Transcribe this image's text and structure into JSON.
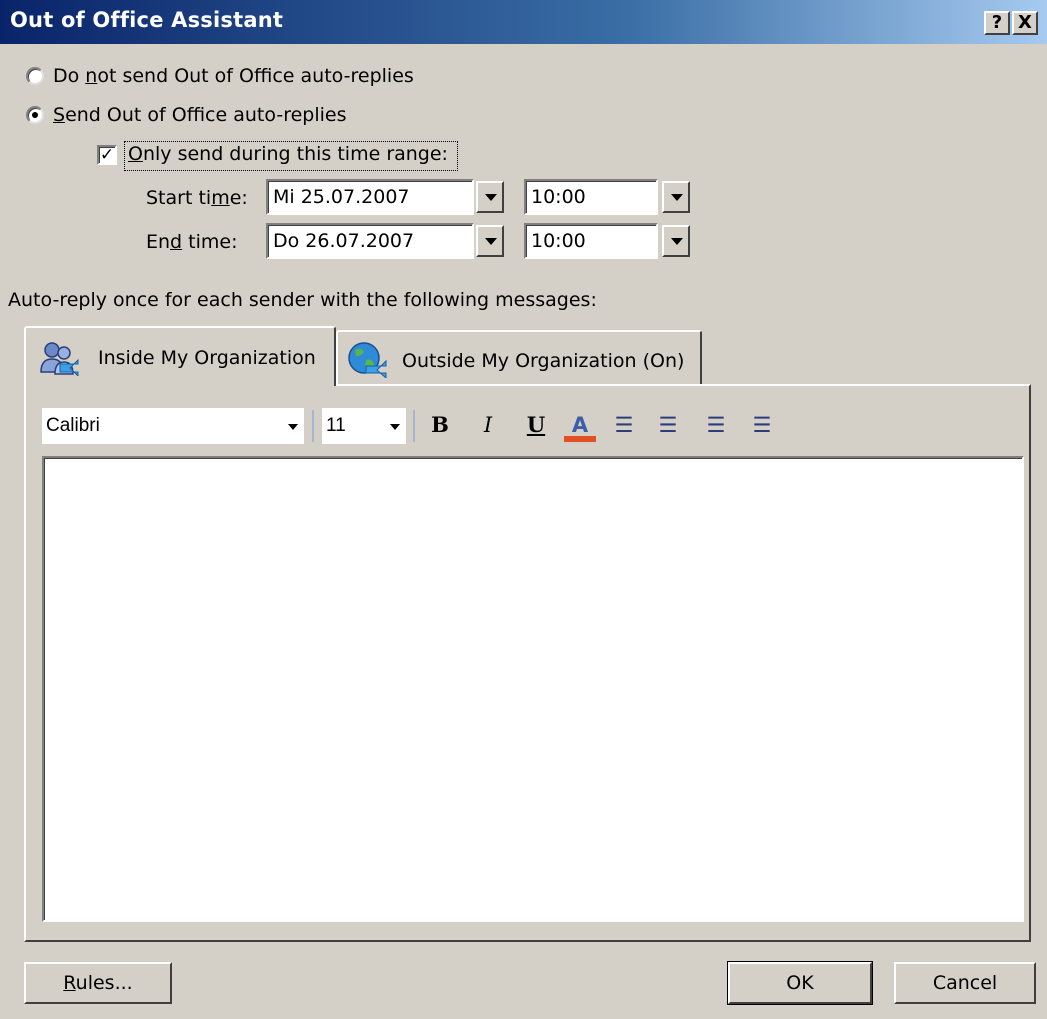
{
  "window": {
    "title": "Out of Office Assistant",
    "help_label": "?",
    "close_label": "X"
  },
  "options": {
    "no_send": {
      "pre": "Do ",
      "key": "n",
      "post": "ot send Out of Office auto-replies",
      "selected": false
    },
    "send": {
      "pre": "",
      "key": "S",
      "post": "end Out of Office auto-replies",
      "selected": true
    },
    "time_range": {
      "pre": "",
      "key": "O",
      "post": "nly send during this time range:",
      "checked": true,
      "check_glyph": "✓"
    }
  },
  "schedule": {
    "start": {
      "label_pre": "Start ti",
      "label_key": "m",
      "label_post": "e:",
      "date": "Mi 25.07.2007",
      "time": "10:00"
    },
    "end": {
      "label_pre": "En",
      "label_key": "d",
      "label_post": " time:",
      "date": "Do 26.07.2007",
      "time": "10:00"
    }
  },
  "messages_label": "Auto-reply once for each sender with the following messages:",
  "tabs": [
    {
      "label": "Inside My Organization",
      "icon": "people-icon",
      "active": true
    },
    {
      "label": "Outside My Organization (On)",
      "icon": "globe-icon",
      "active": false
    }
  ],
  "format_toolbar": {
    "font": "Calibri",
    "size": "11",
    "bold": "B",
    "italic": "I",
    "underline": "U",
    "font_color_glyph": "A",
    "font_color": "#e05020",
    "bullets_glyph": "☰",
    "numbering_glyph": "☰",
    "decrease_indent_glyph": "☰",
    "increase_indent_glyph": "☰"
  },
  "editor": {
    "content": ""
  },
  "buttons": {
    "rules": {
      "key": "R",
      "post": "ules..."
    },
    "ok": "OK",
    "cancel": "Cancel"
  }
}
